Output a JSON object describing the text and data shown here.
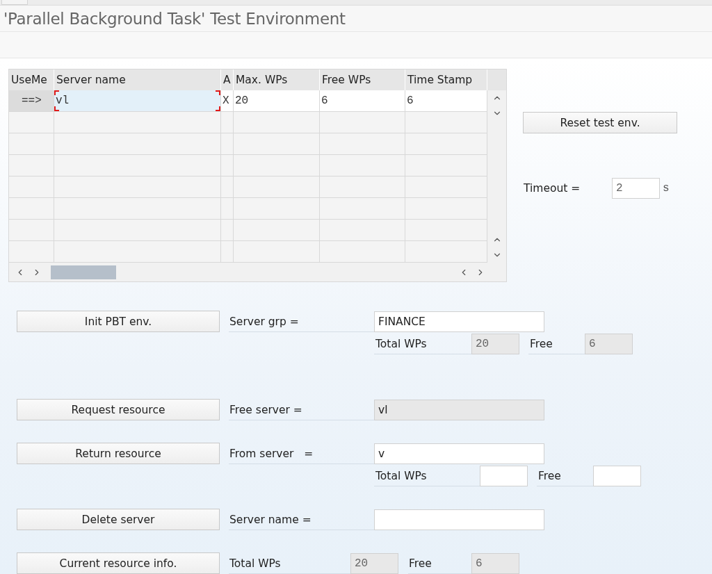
{
  "title": "'Parallel Background Task' Test Environment",
  "table": {
    "columns": [
      "UseMe",
      "Server name",
      "A",
      "Max. WPs",
      "Free WPs",
      "Time Stamp"
    ],
    "rows": [
      {
        "selected": true,
        "cells": [
          {
            "text": "==>"
          },
          {
            "text": "vl",
            "focused": true
          },
          {
            "text": "X"
          },
          {
            "text": "20"
          },
          {
            "text": "6"
          },
          {
            "text": "6"
          }
        ]
      }
    ]
  },
  "reset_button": "Reset test env.",
  "timeout": {
    "label": "Timeout =",
    "value": "2",
    "unit": "s"
  },
  "actions": [
    {
      "kind": "form",
      "button": "Init PBT env.",
      "label": "Server grp =",
      "field": {
        "value": "FINANCE",
        "readonly": false
      },
      "extra": [
        {
          "label": "Total WPs",
          "field": {
            "value": "20",
            "readonly": true
          }
        },
        {
          "label": "Free",
          "field": {
            "value": "6",
            "readonly": true
          }
        }
      ]
    },
    {
      "kind": "form",
      "button": "Request resource",
      "label": "Free server =",
      "field": {
        "value": "vl",
        "readonly": true
      }
    },
    {
      "kind": "form",
      "button": "Return resource",
      "label": "From server   =",
      "field": {
        "value": "v",
        "readonly": false
      },
      "extra": [
        {
          "label": "Total WPs",
          "field": {
            "readonly": false
          }
        },
        {
          "label": "Free",
          "field": {
            "readonly": false
          }
        }
      ]
    },
    {
      "kind": "form",
      "button": "Delete server",
      "label": "Server name =",
      "field": {
        "readonly": false
      }
    },
    {
      "kind": "inline",
      "button": "Current resource info.",
      "items": [
        {
          "label": "Total WPs",
          "field": {
            "value": "20",
            "readonly": true
          }
        },
        {
          "label": "Free",
          "field": {
            "value": "6",
            "readonly": true
          }
        }
      ]
    }
  ]
}
